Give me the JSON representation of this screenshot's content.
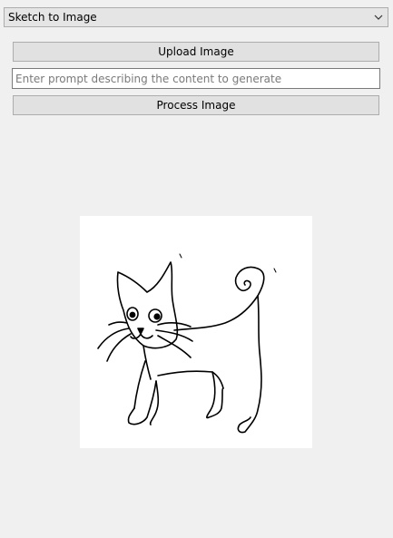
{
  "mode_select": {
    "selected": "Sketch to Image",
    "icon": "chevron-down-icon"
  },
  "upload_button": {
    "label": "Upload Image"
  },
  "prompt_input": {
    "value": "",
    "placeholder": "Enter prompt describing the content to generate"
  },
  "process_button": {
    "label": "Process Image"
  },
  "preview": {
    "content": "cat sketch",
    "background": "#ffffff",
    "stroke": "#000000"
  }
}
